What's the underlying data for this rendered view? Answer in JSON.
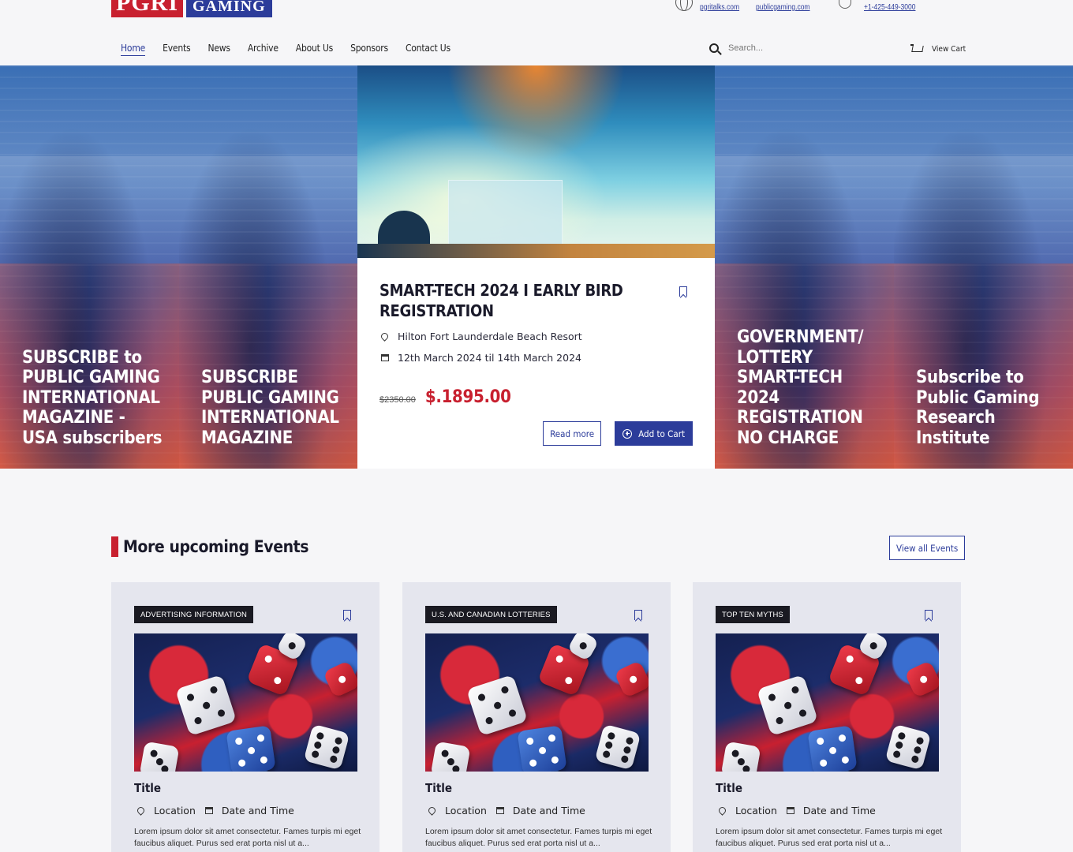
{
  "brand": {
    "logo_left": "PGRI",
    "logo_right": "GAMING",
    "red": "#c8202f",
    "blue": "#2c3c9a"
  },
  "contacts": {
    "site1": "pgritalks.com",
    "site2": "publicgaming.com",
    "phone": "+1-425-449-3000",
    "icons": [
      "globe-icon",
      "phone-icon"
    ]
  },
  "nav": {
    "items": [
      "Home",
      "Events",
      "News",
      "Archive",
      "About Us",
      "Sponsors",
      "Contact Us"
    ],
    "search_placeholder": "Search...",
    "cart_label": "View Cart"
  },
  "hero": {
    "tiles": [
      "SUBSCRIBE to PUBLIC GAMING INTERNATIONAL MAGAZINE - USA subscribers",
      "SUBSCRIBE PUBLIC GAMING INTERNATIONAL MAGAZINE",
      "GOVERNMENT/ LOTTERY SMART-TECH 2024 REGISTRATION NO CHARGE",
      "Subscribe to Public Gaming Research Institute"
    ],
    "featured": {
      "title": "SMART-TECH 2024 I EARLY BIRD REGISTRATION",
      "location": "Hilton Fort Launderdale Beach Resort",
      "dates": "12th March 2024 til 14th March 2024",
      "price_old": "$2350.00",
      "price_new": "$.1895.00",
      "read_more": "Read more",
      "add_to_cart": "Add to Cart"
    }
  },
  "upcoming": {
    "heading": "More upcoming Events",
    "view_all": "View all Events",
    "cards": [
      {
        "tag": "ADVERTISING INFORMATION",
        "title": "Title",
        "location": "Location",
        "datetime": "Date and Time",
        "desc": "Lorem ipsum dolor sit amet consectetur. Fames turpis mi eget faucibus aliquet. Purus sed erat porta nisl ut a..."
      },
      {
        "tag": "U.S. AND CANADIAN LOTTERIES",
        "title": "Title",
        "location": "Location",
        "datetime": "Date and Time",
        "desc": "Lorem ipsum dolor sit amet consectetur. Fames turpis mi eget faucibus aliquet. Purus sed erat porta nisl ut a..."
      },
      {
        "tag": "TOP TEN MYTHS",
        "title": "Title",
        "location": "Location",
        "datetime": "Date and Time",
        "desc": "Lorem ipsum dolor sit amet consectetur. Fames turpis mi eget faucibus aliquet. Purus sed erat porta nisl ut a..."
      }
    ]
  }
}
